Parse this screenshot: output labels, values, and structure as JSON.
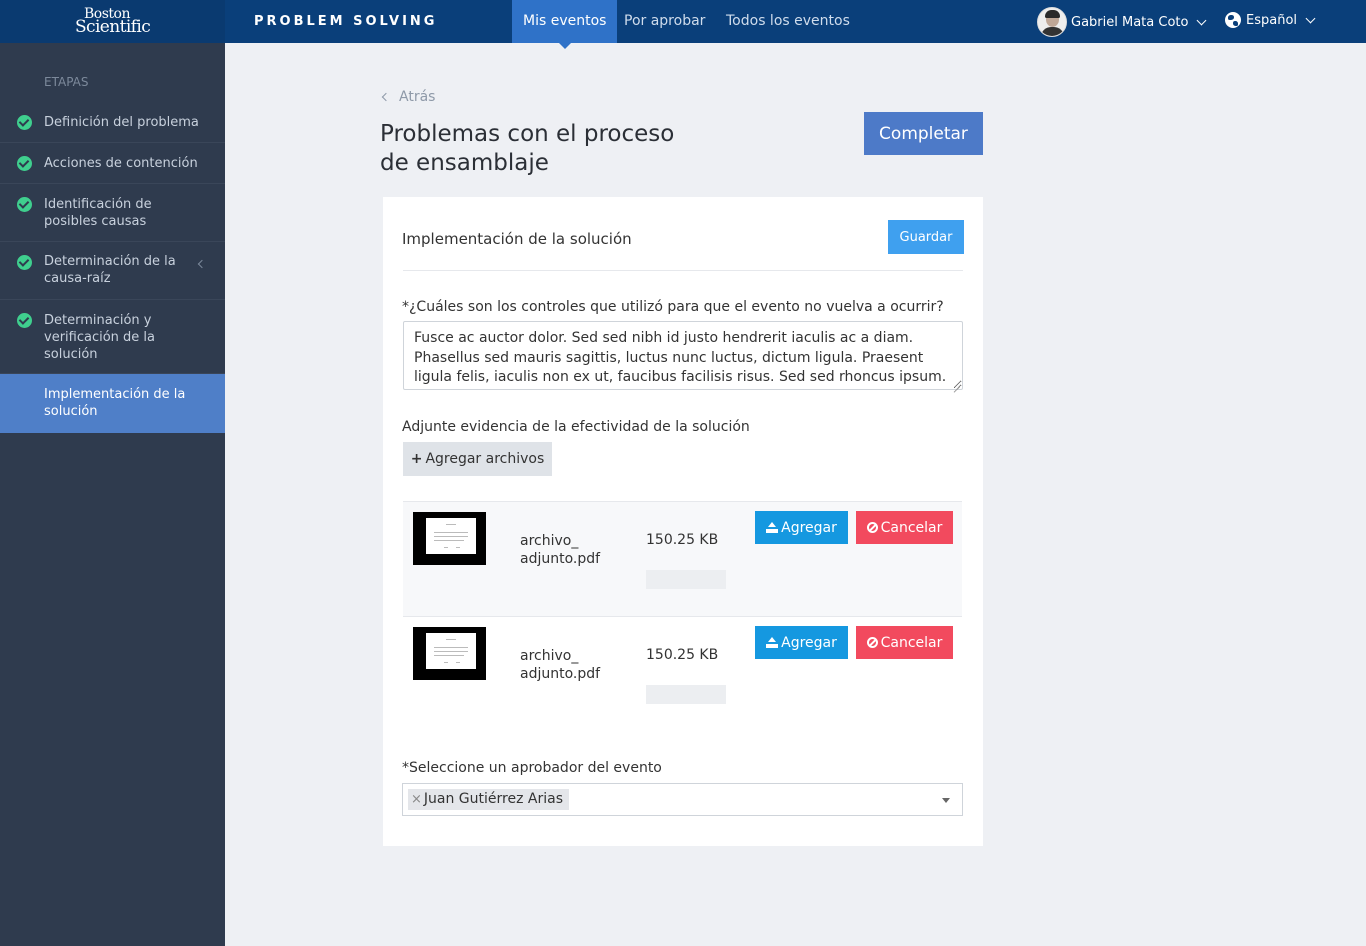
{
  "brand": {
    "line1": "Boston",
    "line2": "Scientific"
  },
  "app_title": "PROBLEM SOLVING",
  "nav": {
    "tabs": [
      {
        "label": "Mis eventos",
        "active": true
      },
      {
        "label": "Por aprobar",
        "active": false
      },
      {
        "label": "Todos los eventos",
        "active": false
      }
    ]
  },
  "user": {
    "name": "Gabriel Mata Coto",
    "icon": "avatar"
  },
  "language": {
    "label": "Español",
    "icon": "globe-icon"
  },
  "sidebar": {
    "heading": "ETAPAS",
    "items": [
      {
        "label": "Definición del problema",
        "done": true
      },
      {
        "label": "Acciones de contención",
        "done": true
      },
      {
        "label": "Identificación de posibles causas",
        "done": true
      },
      {
        "label": "Determinación de la causa-raíz",
        "done": true
      },
      {
        "label": "Determinación y verificación de la solución",
        "done": true
      },
      {
        "label": "Implementación de la solución",
        "done": false,
        "active": true
      }
    ]
  },
  "main": {
    "back_label": "Atrás",
    "title": "Problemas con el proceso de ensamblaje",
    "complete_label": "Completar"
  },
  "card": {
    "title": "Implementación de la solución",
    "save_label": "Guardar",
    "question": "*¿Cuáles son los controles que utilizó para que el evento no vuelva a ocurrir?",
    "answer": "Fusce ac auctor dolor. Sed sed nibh id justo hendrerit iaculis ac a diam. Phasellus sed mauris sagittis, luctus nunc luctus, dictum ligula. Praesent ligula felis, iaculis non ex ut, faucibus facilisis risus. Sed sed rhoncus ipsum.",
    "attach_label": "Adjunte evidencia de la efectividad de la solución",
    "add_files_label": "Agregar archivos",
    "files": [
      {
        "name": "archivo_ adjunto.pdf",
        "size": "150.25 KB",
        "upload_label": "Agregar",
        "cancel_label": "Cancelar"
      },
      {
        "name": "archivo_ adjunto.pdf",
        "size": "150.25 KB",
        "upload_label": "Agregar",
        "cancel_label": "Cancelar"
      }
    ],
    "approver_label": "*Seleccione un aprobador del evento",
    "approver_selected": "Juan Gutiérrez Arias",
    "tag_remove": "×"
  },
  "colors": {
    "topbar": "#0a3f7a",
    "nav_active": "#2f72c8",
    "sidebar": "#2f3b4e",
    "sidebar_active": "#4f7fc8",
    "check": "#3fcf8e",
    "primary": "#4d7ac8",
    "upload": "#1598e0",
    "cancel": "#f24a5e"
  }
}
